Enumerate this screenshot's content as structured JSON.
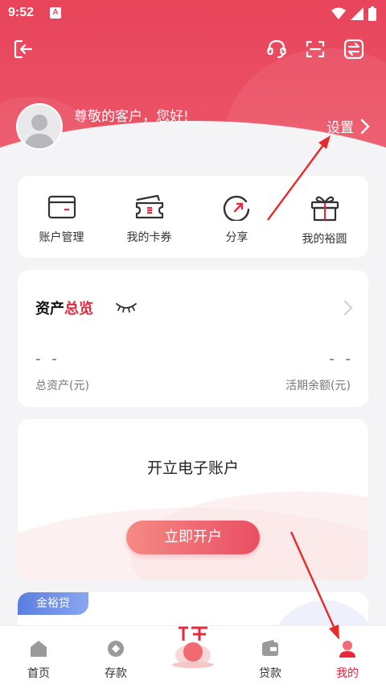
{
  "status_bar": {
    "time": "9:52",
    "badge": "A"
  },
  "profile": {
    "greeting": "尊敬的客户，您好!",
    "settings_label": "设置"
  },
  "quick_actions": [
    {
      "label": "账户管理",
      "icon": "card-icon"
    },
    {
      "label": "我的卡券",
      "icon": "ticket-icon"
    },
    {
      "label": "分享",
      "icon": "share-icon"
    },
    {
      "label": "我的裕圆",
      "icon": "gift-icon"
    }
  ],
  "assets": {
    "title_part1": "资产",
    "title_part2": "总览",
    "total_value": "- -",
    "total_label": "总资产(元)",
    "current_value": "- -",
    "current_label": "活期余额(元)"
  },
  "open_account": {
    "heading": "开立电子账户",
    "button_label": "立即开户"
  },
  "loan": {
    "tag": "金裕贷"
  },
  "tabs": [
    {
      "label": "首页",
      "icon": "home-icon"
    },
    {
      "label": "存款",
      "icon": "deposit-icon"
    },
    {
      "label": "",
      "icon": "earn-icon"
    },
    {
      "label": "贷款",
      "icon": "loan-icon"
    },
    {
      "label": "我的",
      "icon": "user-icon",
      "active": true
    }
  ],
  "colors": {
    "brand": "#e8445a",
    "highlight": "#e8283d",
    "loan_tag": "#5b7ee0"
  }
}
